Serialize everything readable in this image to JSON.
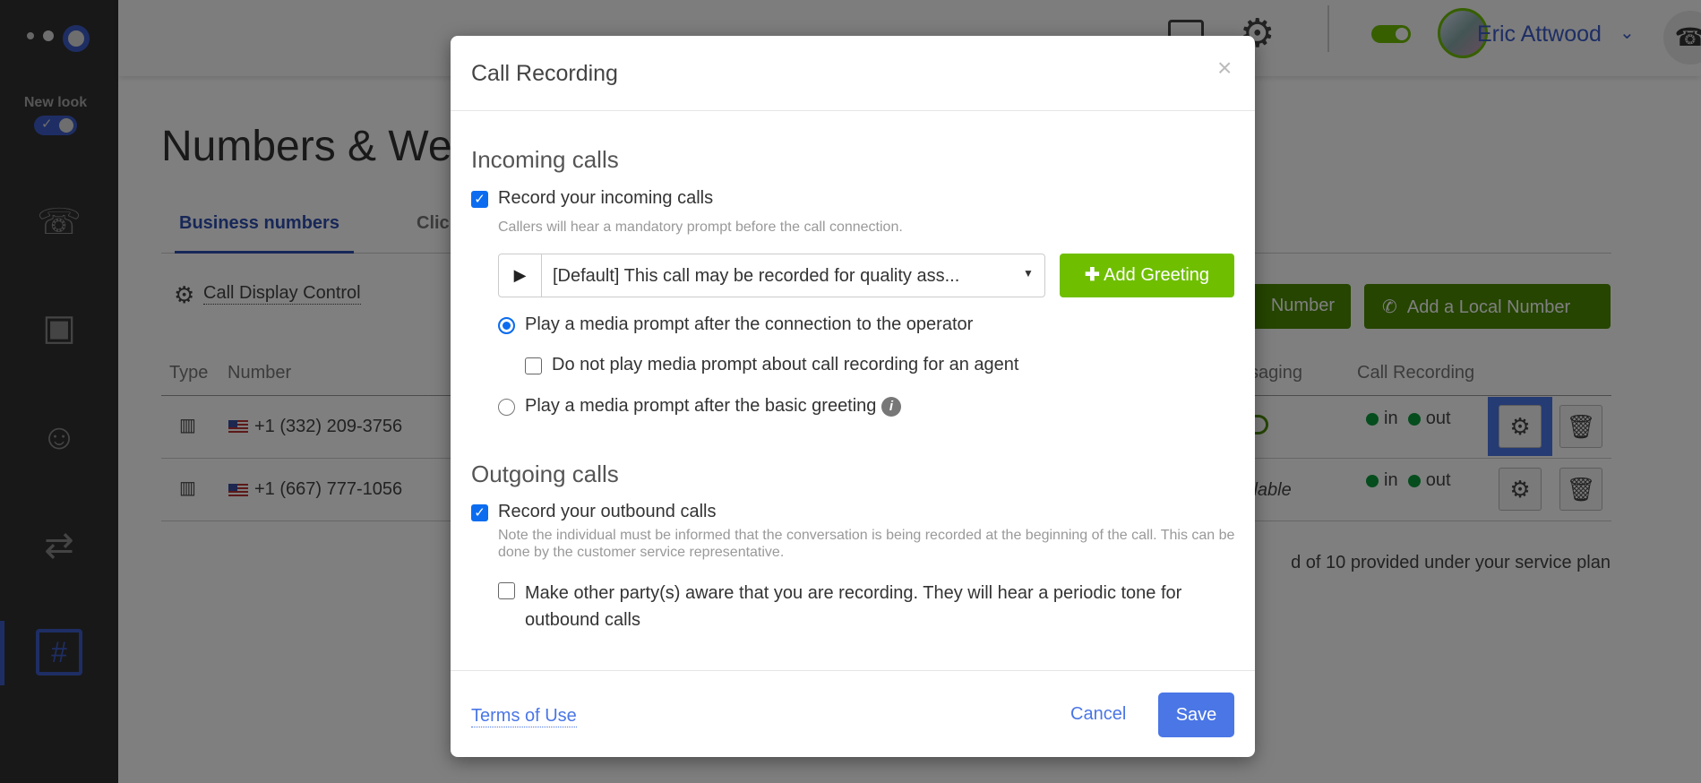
{
  "sidebar": {
    "new_look_label": "New look",
    "new_look_on": true,
    "items": [
      {
        "icon": "calendar-phone-icon"
      },
      {
        "icon": "contacts-book-icon"
      },
      {
        "icon": "agent-headset-icon"
      },
      {
        "icon": "call-routing-icon"
      },
      {
        "icon": "numbers-icon",
        "active": true
      }
    ]
  },
  "topbar": {
    "user_name": "Eric Attwood",
    "status_toggle_on": true
  },
  "page": {
    "title": "Numbers & We",
    "tabs": [
      {
        "label": "Business numbers",
        "active": true
      },
      {
        "label": "Clic"
      }
    ],
    "call_display_control": "Call Display Control",
    "buttons": {
      "add_toll_free": "Number",
      "add_local": "Add a Local Number"
    },
    "table": {
      "headers": [
        "Type",
        "Number",
        "ssaging",
        "Call Recording"
      ],
      "rows": [
        {
          "number": "+1 (332) 209-3756",
          "messaging": "",
          "rec_in": "in",
          "rec_out": "out"
        },
        {
          "number": "+1 (667) 777-1056",
          "messaging": "ilable",
          "rec_in": "in",
          "rec_out": "out"
        }
      ]
    },
    "footer_note": "d of 10 provided under your service plan"
  },
  "modal": {
    "title": "Call Recording",
    "close": "×",
    "incoming": {
      "heading": "Incoming calls",
      "record_label": "Record your incoming calls",
      "record_checked": true,
      "hint": "Callers will hear a mandatory prompt before the call connection.",
      "greeting_selected": "[Default] This call may be recorded for quality ass...",
      "add_greeting": "Add Greeting",
      "option_after_operator": "Play a media prompt after the connection to the operator",
      "option_after_operator_selected": true,
      "no_prompt_agent": "Do not play media prompt about call recording for an agent",
      "no_prompt_agent_checked": false,
      "option_after_greeting": "Play a media prompt after the basic greeting",
      "option_after_greeting_selected": false
    },
    "outgoing": {
      "heading": "Outgoing calls",
      "record_label": "Record your outbound calls",
      "record_checked": true,
      "hint": "Note the individual must be informed that the conversation is being recorded at the beginning of the call. This can be done by the customer service representative.",
      "tone_label": "Make other party(s) aware that you are recording. They will hear a periodic tone for outbound calls",
      "tone_checked": false
    },
    "footer": {
      "terms": "Terms of Use",
      "cancel": "Cancel",
      "save": "Save"
    }
  },
  "colors": {
    "primary": "#4a76e6",
    "green": "#6fbf00",
    "dark_green": "#4a8a00",
    "checkbox": "#0b6cf0",
    "status_dot": "#0a9a3a"
  }
}
